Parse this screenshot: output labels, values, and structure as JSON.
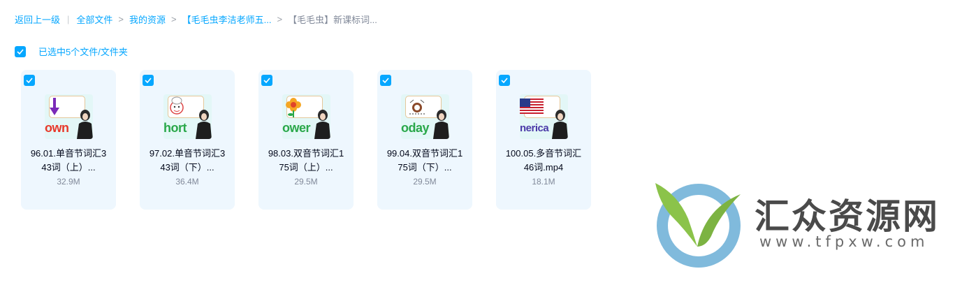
{
  "breadcrumb": {
    "back": "返回上一级",
    "items": [
      "全部文件",
      "我的资源",
      "【毛毛虫李洁老师五..."
    ],
    "current": "【毛毛虫】新课标词..."
  },
  "selection": {
    "label": "已选中5个文件/文件夹",
    "checked": true
  },
  "files": [
    {
      "name_line1": "96.01.单音节词汇3",
      "name_line2": "43词（上）...",
      "size": "32.9M",
      "thumb_word": "own",
      "thumb_color": "#e8392a",
      "thumb_icon": "down-arrow-icon",
      "checked": true
    },
    {
      "name_line1": "97.02.单音节词汇3",
      "name_line2": "43词（下）...",
      "size": "36.4M",
      "thumb_word": "hort",
      "thumb_color": "#2aa84a",
      "thumb_icon": "chef-icon",
      "checked": true
    },
    {
      "name_line1": "98.03.双音节词汇1",
      "name_line2": "75词（上）...",
      "size": "29.5M",
      "thumb_word": "ower",
      "thumb_color": "#2aa84a",
      "thumb_icon": "flower-icon",
      "checked": true
    },
    {
      "name_line1": "99.04.双音节词汇1",
      "name_line2": "75词（下）...",
      "size": "29.5M",
      "thumb_word": "oday",
      "thumb_color": "#2aa84a",
      "thumb_icon": "clock-icon",
      "checked": true
    },
    {
      "name_line1": "100.05.多音节词汇",
      "name_line2": "46词.mp4",
      "size": "18.1M",
      "thumb_word": "nerica",
      "thumb_color": "#4a3aa8",
      "thumb_icon": "us-flag-icon",
      "checked": true
    }
  ],
  "watermark": {
    "text": "汇众资源网",
    "url": "www.tfpxw.com"
  },
  "colors": {
    "accent": "#06a7ff",
    "card_bg": "#eef7fe",
    "text": "#03081a",
    "muted": "#818999"
  }
}
